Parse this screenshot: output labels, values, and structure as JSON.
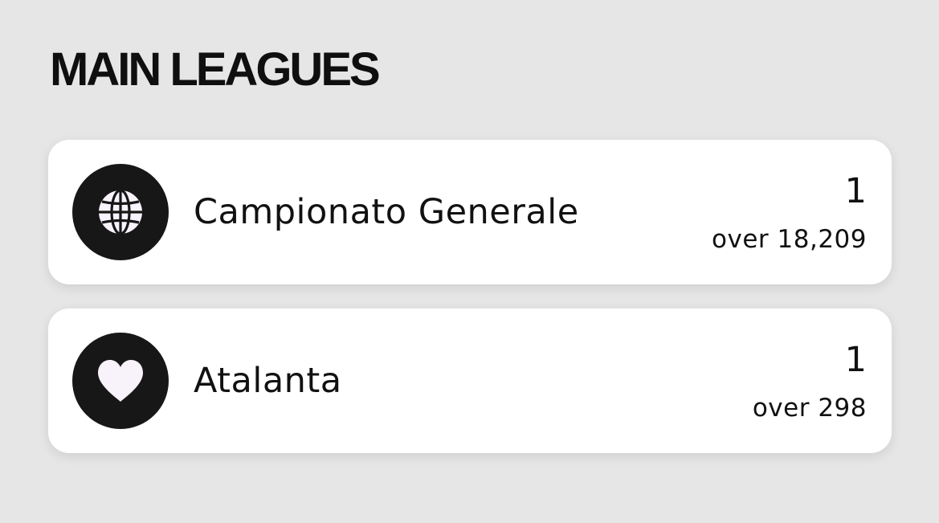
{
  "section": {
    "title": "MAIN LEAGUES"
  },
  "leagues": [
    {
      "icon": "globe-icon",
      "name": "Campionato Generale",
      "rank": "1",
      "total": "over 18,209"
    },
    {
      "icon": "heart-icon",
      "name": "Atalanta",
      "rank": "1",
      "total": "over 298"
    }
  ],
  "colors": {
    "background": "#e6e6e6",
    "card": "#ffffff",
    "icon_bg": "#171717",
    "icon_fg": "#f8f2fb",
    "text": "#111111"
  }
}
